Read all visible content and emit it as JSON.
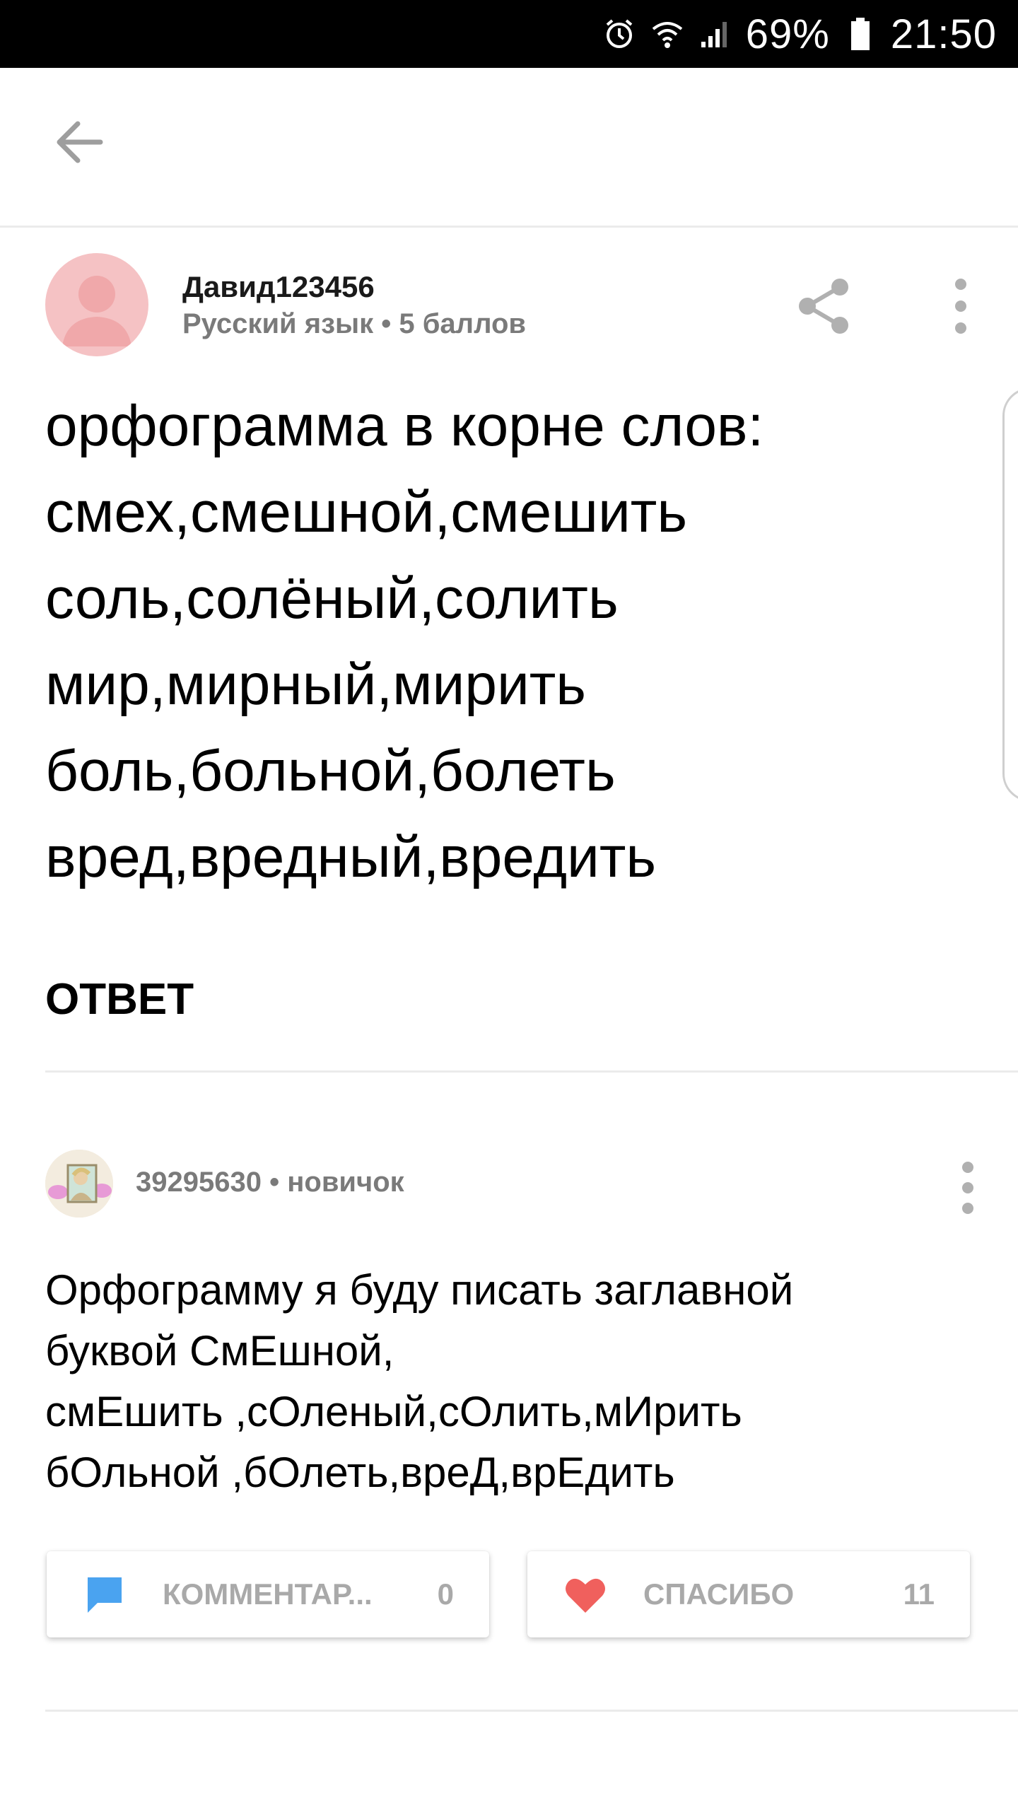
{
  "status_bar": {
    "battery": "69%",
    "time": "21:50",
    "icons": [
      "alarm-icon",
      "wifi-icon",
      "signal-icon",
      "battery-icon"
    ]
  },
  "app_bar": {
    "back_icon": "arrow-left-icon"
  },
  "question": {
    "author": "Давид123456",
    "meta": "Русский язык • 5 баллов",
    "text": "орфограмма в корне слов:\nсмех,смешной,смешить\nсоль,солёный,солить\nмир,мирный,мирить\nболь,больной,болеть\nвред,вредный,вредить",
    "share_icon": "share-icon",
    "more_icon": "more-vert-icon"
  },
  "answer_heading": "ОТВЕТ",
  "answer": {
    "author": "39295630",
    "rank": "новичок",
    "separator": "•",
    "text": "Орфограмму я буду писать заглавной\nбуквой СмЕшной,\nсмЕшить ,сОленый,сОлить,мИрить\nбОльной ,бОлеть,вреД,врЕдить",
    "more_icon": "more-vert-icon"
  },
  "actions": {
    "comment": {
      "label": "КОММЕНТАР...",
      "count": "0",
      "icon": "comment-icon",
      "icon_color": "#4aa3f0"
    },
    "thanks": {
      "label": "СПАСИБО",
      "count": "11",
      "icon": "heart-icon",
      "icon_color": "#f0605d"
    }
  },
  "colors": {
    "muted_text": "#7a7a7a",
    "button_text": "#a9a9a9",
    "avatar_bg": "#f5c2c4"
  }
}
